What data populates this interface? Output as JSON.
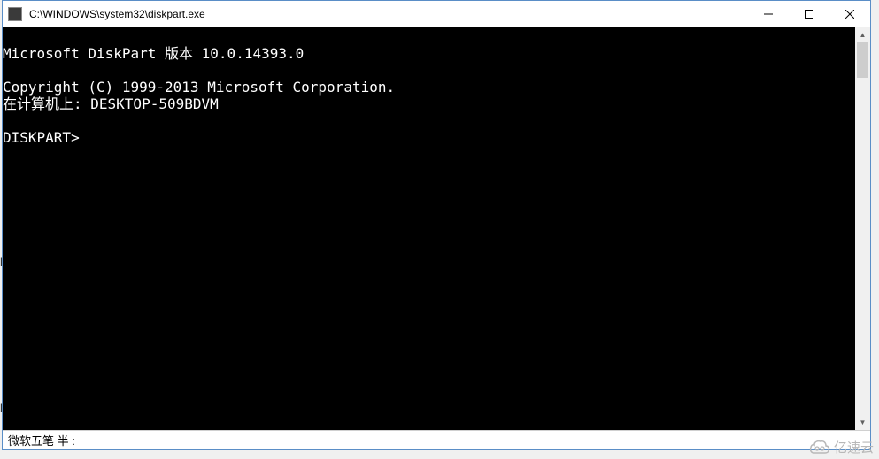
{
  "window": {
    "title": "C:\\WINDOWS\\system32\\diskpart.exe"
  },
  "console": {
    "line1": "Microsoft DiskPart 版本 10.0.14393.0",
    "line2": "",
    "line3": "Copyright (C) 1999-2013 Microsoft Corporation.",
    "line4": "在计算机上: DESKTOP-509BDVM",
    "line5": "",
    "line6": "DISKPART>"
  },
  "ime": {
    "status": "微软五笔 半 :"
  },
  "background": {
    "mark_k1": "k",
    "mark_k2": "k"
  },
  "watermark": {
    "text": "亿速云"
  }
}
